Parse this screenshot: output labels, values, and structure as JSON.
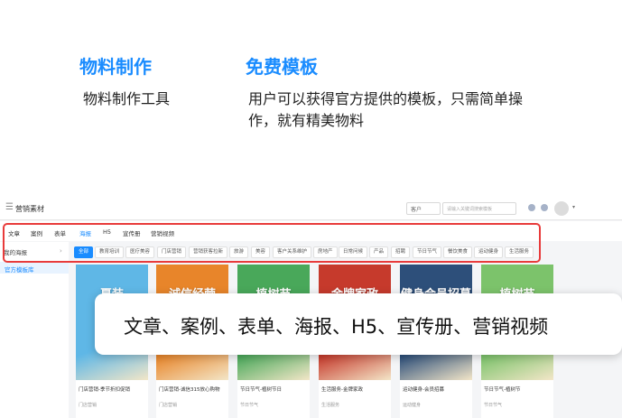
{
  "features": [
    {
      "title": "物料制作",
      "desc": "物料制作工具"
    },
    {
      "title": "免费模板",
      "desc": "用户可以获得官方提供的模板，只需简单操作，就有精美物料"
    }
  ],
  "app": {
    "title": "营销素材",
    "type_select": "客户",
    "search_placeholder": "请输入关键词搜索模板",
    "tabs": [
      "文章",
      "案例",
      "表单",
      "海报",
      "H5",
      "宣传册",
      "营销视频"
    ],
    "active_tab": "海报",
    "sidebar": [
      {
        "label": "我的海报"
      },
      {
        "label": "官方模板库"
      }
    ],
    "filters": [
      "全部",
      "教育培训",
      "医疗美容",
      "门店营销",
      "营销获客拉新",
      "旅游",
      "美容",
      "客户关系维护",
      "房地产",
      "日常问候",
      "产品",
      "招聘",
      "节日节气",
      "餐饮美食",
      "运动健身",
      "生活服务"
    ],
    "cards": [
      {
        "thumb_text": "夏装",
        "caption": "门店营销-季节折扣促销",
        "sub": "门店营销",
        "color": "#5fb7e6"
      },
      {
        "thumb_text": "诚信经营",
        "caption": "门店营销-诚信315放心购物",
        "sub": "门店营销",
        "color": "#e8852a"
      },
      {
        "thumb_text": "植树节",
        "caption": "节日节气-植树节日",
        "sub": "节日节气",
        "color": "#49a85a"
      },
      {
        "thumb_text": "金牌家政",
        "caption": "生活服务-金牌家政",
        "sub": "生活服务",
        "color": "#c63a2c"
      },
      {
        "thumb_text": "健身会员招募",
        "caption": "运动健身-会员招募",
        "sub": "运动健身",
        "color": "#2d4f7a"
      },
      {
        "thumb_text": "植树节",
        "caption": "节日节气-植树节",
        "sub": "节日节气",
        "color": "#7cc36b"
      }
    ]
  },
  "overlay": "文章、案例、表单、海报、H5、宣传册、营销视频",
  "colors": {
    "accent": "#1a8cff",
    "frame": "#e83b3b"
  }
}
